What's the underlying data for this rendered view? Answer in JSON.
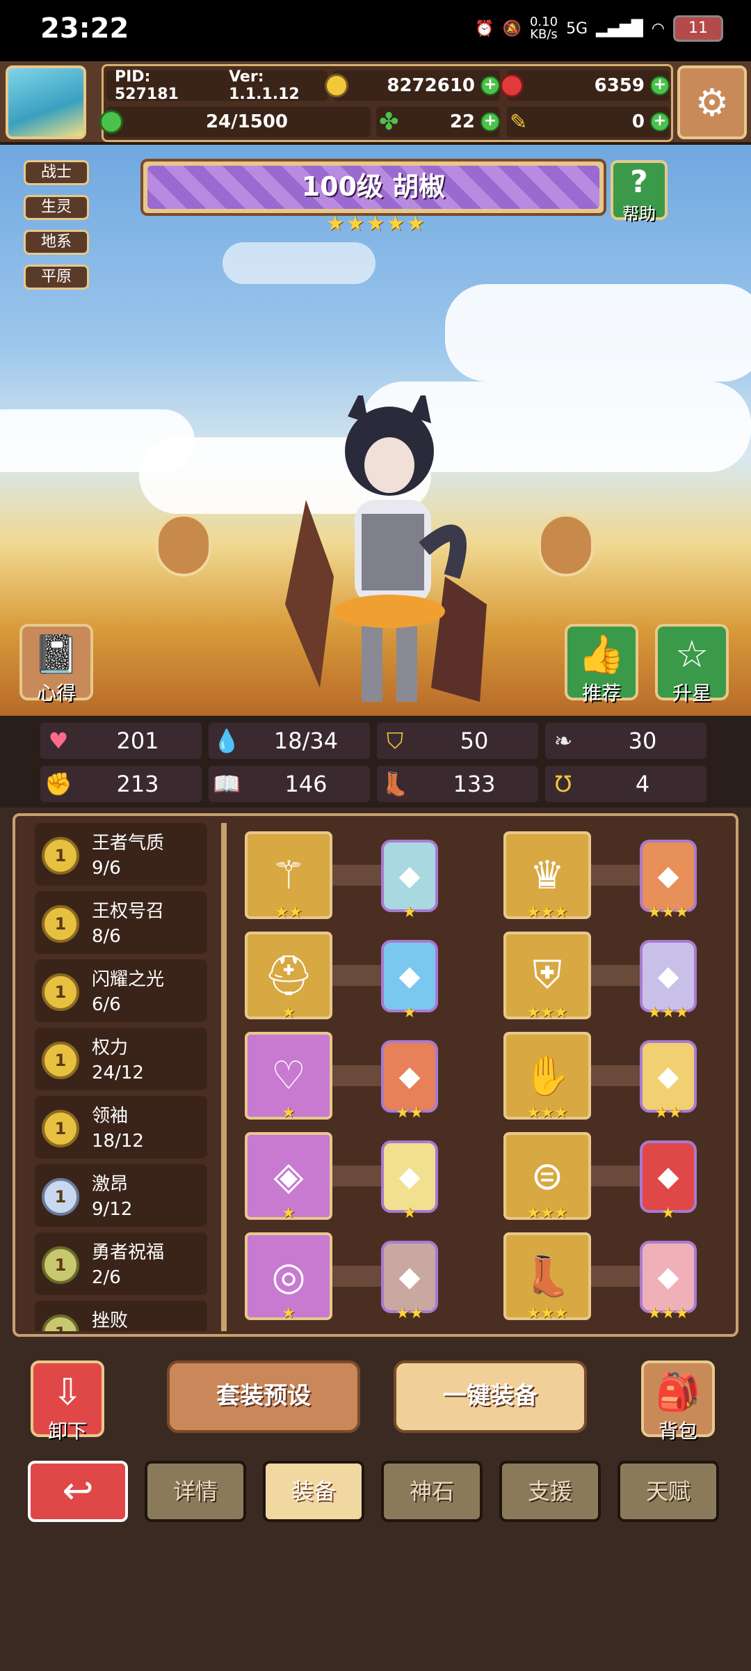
{
  "status": {
    "time": "23:22",
    "net_speed": "0.10\nKB/s",
    "signal": "5G",
    "battery": "11"
  },
  "topbar": {
    "pid": "PID: 527181",
    "version": "Ver: 1.1.1.12",
    "gold": "8272610",
    "gems": "6359",
    "stamina": "24/1500",
    "clover": "22",
    "item": "0"
  },
  "tags": [
    "战士",
    "生灵",
    "地系",
    "平原"
  ],
  "hero": {
    "level_name": "100级  胡椒",
    "stars": 5
  },
  "buttons": {
    "help": "帮助",
    "insight": "心得",
    "recommend": "推荐",
    "star_up": "升星",
    "unequip": "卸下",
    "preset": "套装预设",
    "equip_all": "一键装备",
    "bag": "背包"
  },
  "stats": [
    {
      "icon": "heart-icon",
      "value": "201"
    },
    {
      "icon": "water-drop-icon",
      "value": "18/34"
    },
    {
      "icon": "shield-icon",
      "value": "50"
    },
    {
      "icon": "wing-icon",
      "value": "30"
    },
    {
      "icon": "fist-icon",
      "value": "213"
    },
    {
      "icon": "book-icon",
      "value": "146"
    },
    {
      "icon": "boot-icon",
      "value": "133"
    },
    {
      "icon": "horseshoe-icon",
      "value": "4"
    }
  ],
  "sets": [
    {
      "name": "王者气质",
      "progress": "9/6"
    },
    {
      "name": "王权号召",
      "progress": "8/6"
    },
    {
      "name": "闪耀之光",
      "progress": "6/6"
    },
    {
      "name": "权力",
      "progress": "24/12"
    },
    {
      "name": "领袖",
      "progress": "18/12"
    },
    {
      "name": "激昂",
      "progress": "9/12"
    },
    {
      "name": "勇者祝福",
      "progress": "2/6"
    },
    {
      "name": "挫败",
      "progress": ""
    }
  ],
  "equipment": [
    {
      "item_icon": "scepter-icon",
      "item_stars": 2,
      "item_color": "gold",
      "rune_stars": 1
    },
    {
      "item_icon": "crown-ring-icon",
      "item_stars": 3,
      "item_color": "gold",
      "rune_stars": 3
    },
    {
      "item_icon": "helmet-icon",
      "item_stars": 1,
      "item_color": "gold",
      "rune_stars": 1
    },
    {
      "item_icon": "armor-icon",
      "item_stars": 3,
      "item_color": "gold",
      "rune_stars": 3
    },
    {
      "item_icon": "necklace-icon",
      "item_stars": 1,
      "item_color": "purple",
      "rune_stars": 2
    },
    {
      "item_icon": "glove-icon",
      "item_stars": 3,
      "item_color": "gold",
      "rune_stars": 2
    },
    {
      "item_icon": "amulet-icon",
      "item_stars": 1,
      "item_color": "purple",
      "rune_stars": 1
    },
    {
      "item_icon": "belt-icon",
      "item_stars": 3,
      "item_color": "gold",
      "rune_stars": 1
    },
    {
      "item_icon": "ring-icon",
      "item_stars": 1,
      "item_color": "purple",
      "rune_stars": 2
    },
    {
      "item_icon": "boots-icon",
      "item_stars": 3,
      "item_color": "gold",
      "rune_stars": 3
    }
  ],
  "tabs": [
    "详情",
    "装备",
    "神石",
    "支援",
    "天赋"
  ],
  "active_tab": "装备",
  "colors": {
    "accent": "#e8c88a",
    "panel": "#4a2e22",
    "back_button": "#e04848",
    "green_button": "#3a9a4a"
  }
}
